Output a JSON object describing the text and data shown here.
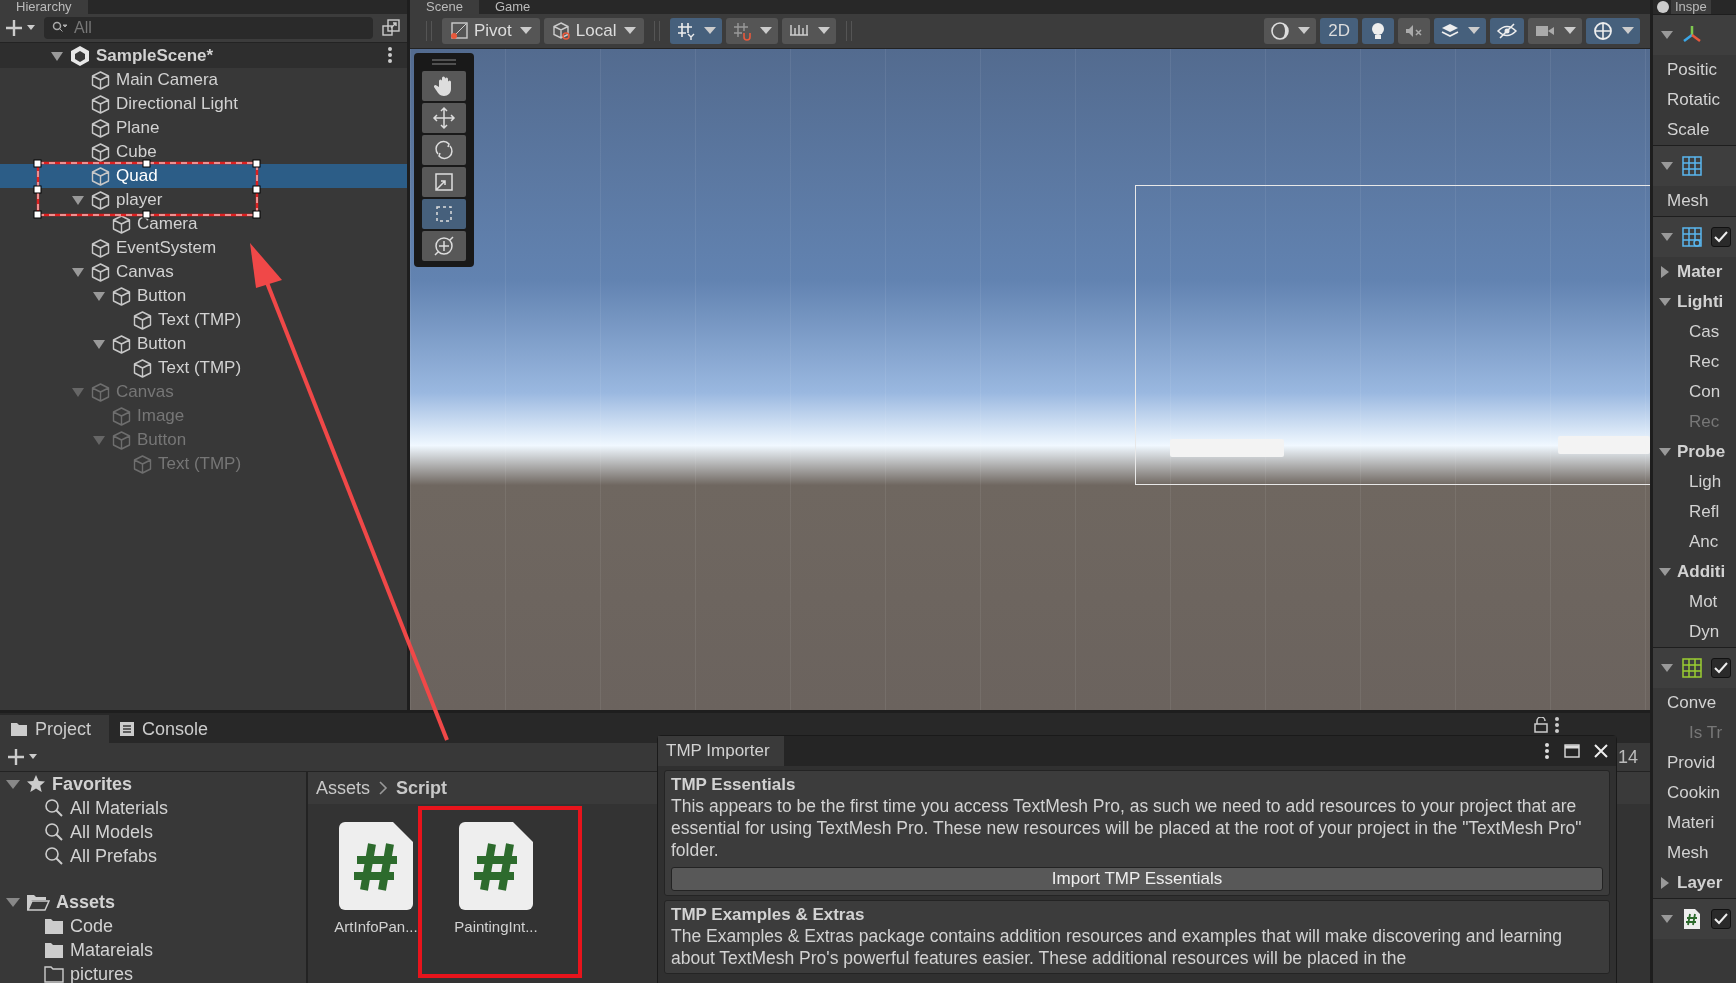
{
  "hierarchy": {
    "tab": "Hierarchy",
    "search": {
      "placeholder": "All"
    },
    "tree": [
      {
        "label": "SampleScene*",
        "kind": "scene",
        "selected": false,
        "disabled": false,
        "expanded": true,
        "children": [
          {
            "label": "Main Camera",
            "kind": "object",
            "selected": false,
            "disabled": false
          },
          {
            "label": "Directional Light",
            "kind": "object",
            "selected": false,
            "disabled": false
          },
          {
            "label": "Plane",
            "kind": "object",
            "selected": false,
            "disabled": false
          },
          {
            "label": "Cube",
            "kind": "object",
            "selected": false,
            "disabled": false
          },
          {
            "label": "Quad",
            "kind": "object",
            "selected": true,
            "disabled": false
          },
          {
            "label": "player",
            "kind": "object",
            "selected": false,
            "disabled": false,
            "expanded": true,
            "children": [
              {
                "label": "Camera",
                "kind": "object",
                "selected": false,
                "disabled": false
              }
            ]
          },
          {
            "label": "EventSystem",
            "kind": "object",
            "selected": false,
            "disabled": false
          },
          {
            "label": "Canvas",
            "kind": "object",
            "selected": false,
            "disabled": false,
            "expanded": true,
            "children": [
              {
                "label": "Button",
                "kind": "object",
                "selected": false,
                "disabled": false,
                "expanded": true,
                "children": [
                  {
                    "label": "Text (TMP)",
                    "kind": "object",
                    "selected": false,
                    "disabled": false
                  }
                ]
              },
              {
                "label": "Button",
                "kind": "object",
                "selected": false,
                "disabled": false,
                "expanded": true,
                "children": [
                  {
                    "label": "Text (TMP)",
                    "kind": "object",
                    "selected": false,
                    "disabled": false
                  }
                ]
              }
            ]
          },
          {
            "label": "Canvas",
            "kind": "object",
            "selected": false,
            "disabled": true,
            "expanded": true,
            "children": [
              {
                "label": "Image",
                "kind": "object",
                "selected": false,
                "disabled": true
              },
              {
                "label": "Button",
                "kind": "object",
                "selected": false,
                "disabled": true,
                "expanded": true,
                "children": [
                  {
                    "label": "Text (TMP)",
                    "kind": "object",
                    "selected": false,
                    "disabled": true
                  }
                ]
              }
            ]
          }
        ]
      }
    ]
  },
  "scene": {
    "tabs": [
      {
        "label": "Scene",
        "selected": true
      },
      {
        "label": "Game",
        "selected": false
      }
    ],
    "toolbar": [
      {
        "kind": "pivot",
        "label": "Pivot",
        "selected": false
      },
      {
        "kind": "local",
        "label": "Local",
        "selected": false
      },
      {
        "kind": "grid",
        "selected": true
      },
      {
        "kind": "snap",
        "selected": false
      },
      {
        "kind": "ruler",
        "selected": false
      },
      {
        "kind": "shading",
        "selected": false
      },
      {
        "kind": "text",
        "label": "2D",
        "selected": true
      },
      {
        "kind": "light",
        "selected": true
      },
      {
        "kind": "audio",
        "selected": false
      },
      {
        "kind": "effects",
        "selected": true
      },
      {
        "kind": "hidden",
        "selected": true
      },
      {
        "kind": "camera",
        "selected": false
      },
      {
        "kind": "gizmo",
        "selected": true
      }
    ],
    "tools": [
      {
        "kind": "hand",
        "selected": false
      },
      {
        "kind": "move",
        "selected": false
      },
      {
        "kind": "rotate",
        "selected": false
      },
      {
        "kind": "scale",
        "selected": false
      },
      {
        "kind": "rect",
        "selected": true
      },
      {
        "kind": "transform",
        "selected": false
      }
    ]
  },
  "inspector": {
    "tab": "Inspe",
    "rows": [
      {
        "kind": "transform"
      },
      {
        "kind": "field",
        "label": "Positic",
        "disabled": false
      },
      {
        "kind": "field",
        "label": "Rotatic",
        "disabled": false
      },
      {
        "kind": "field",
        "label": "Scale",
        "disabled": false
      },
      {
        "kind": "mesh_filter"
      },
      {
        "kind": "field",
        "label": "Mesh",
        "disabled": false
      },
      {
        "kind": "mesh_renderer",
        "checked": true
      },
      {
        "kind": "foldout",
        "label": "Mater",
        "expanded": false
      },
      {
        "kind": "foldout",
        "label": "Lighti",
        "expanded": true,
        "children": [
          {
            "kind": "field",
            "label": "Cas",
            "disabled": false
          },
          {
            "kind": "field",
            "label": "Rec",
            "disabled": false
          },
          {
            "kind": "field",
            "label": "Con",
            "disabled": false
          },
          {
            "kind": "field",
            "label": "Rec",
            "disabled": true
          }
        ]
      },
      {
        "kind": "foldout",
        "label": "Probe",
        "expanded": true,
        "children": [
          {
            "kind": "field",
            "label": "Ligh",
            "disabled": false
          },
          {
            "kind": "field",
            "label": "Refl",
            "disabled": false
          },
          {
            "kind": "field",
            "label": "Anc",
            "disabled": false
          }
        ]
      },
      {
        "kind": "foldout",
        "label": "Additi",
        "expanded": true,
        "children": [
          {
            "kind": "field",
            "label": "Mot",
            "disabled": false
          },
          {
            "kind": "field",
            "label": "Dyn",
            "disabled": false
          }
        ]
      },
      {
        "kind": "mesh_collider",
        "checked": true
      },
      {
        "kind": "field",
        "label": "Conve",
        "disabled": false,
        "children": [
          {
            "kind": "field",
            "label": "Is Tr",
            "disabled": true
          }
        ]
      },
      {
        "kind": "field",
        "label": "Provid",
        "disabled": false
      },
      {
        "kind": "field",
        "label": "Cookin",
        "disabled": false
      },
      {
        "kind": "field",
        "label": "Materi",
        "disabled": false
      },
      {
        "kind": "field",
        "label": "Mesh",
        "disabled": false
      },
      {
        "kind": "foldout",
        "label": "Layer",
        "expanded": false
      },
      {
        "kind": "script",
        "checked": true
      }
    ]
  },
  "project": {
    "tabs": [
      {
        "label": "Project",
        "kind": "project",
        "selected": true
      },
      {
        "label": "Console",
        "kind": "console",
        "selected": false
      }
    ],
    "size_label": "14",
    "sidebar": [
      {
        "label": "Favorites",
        "kind": "favorites",
        "expanded": true,
        "children": [
          {
            "label": "All Materials",
            "kind": "search"
          },
          {
            "label": "All Models",
            "kind": "search"
          },
          {
            "label": "All Prefabs",
            "kind": "search"
          }
        ]
      },
      {
        "label": "Assets",
        "kind": "assets",
        "expanded": true,
        "children": [
          {
            "label": "Code",
            "kind": "folder"
          },
          {
            "label": "Matareials",
            "kind": "folder"
          },
          {
            "label": "pictures",
            "kind": "empty_folder"
          }
        ]
      }
    ],
    "breadcrumb": [
      "Assets",
      "Script"
    ],
    "files": [
      {
        "label": "ArtInfoPan...",
        "kind": "script"
      },
      {
        "label": "PaintingInt...",
        "kind": "script"
      }
    ]
  },
  "tmp_importer": {
    "title": "TMP Importer",
    "sections": [
      {
        "title": "TMP Essentials",
        "body": "This appears to be the first time you access TextMesh Pro, as such we need to add resources to your project that are essential for using TextMesh Pro. These new resources will be placed at the root of your project in the \"TextMesh Pro\" folder.",
        "button": "Import TMP Essentials"
      },
      {
        "title": "TMP Examples & Extras",
        "body": "The Examples & Extras package contains addition resources and examples that will make discovering and learning about TextMesh Pro's powerful features easier. These additional resources will be placed in the"
      }
    ]
  }
}
